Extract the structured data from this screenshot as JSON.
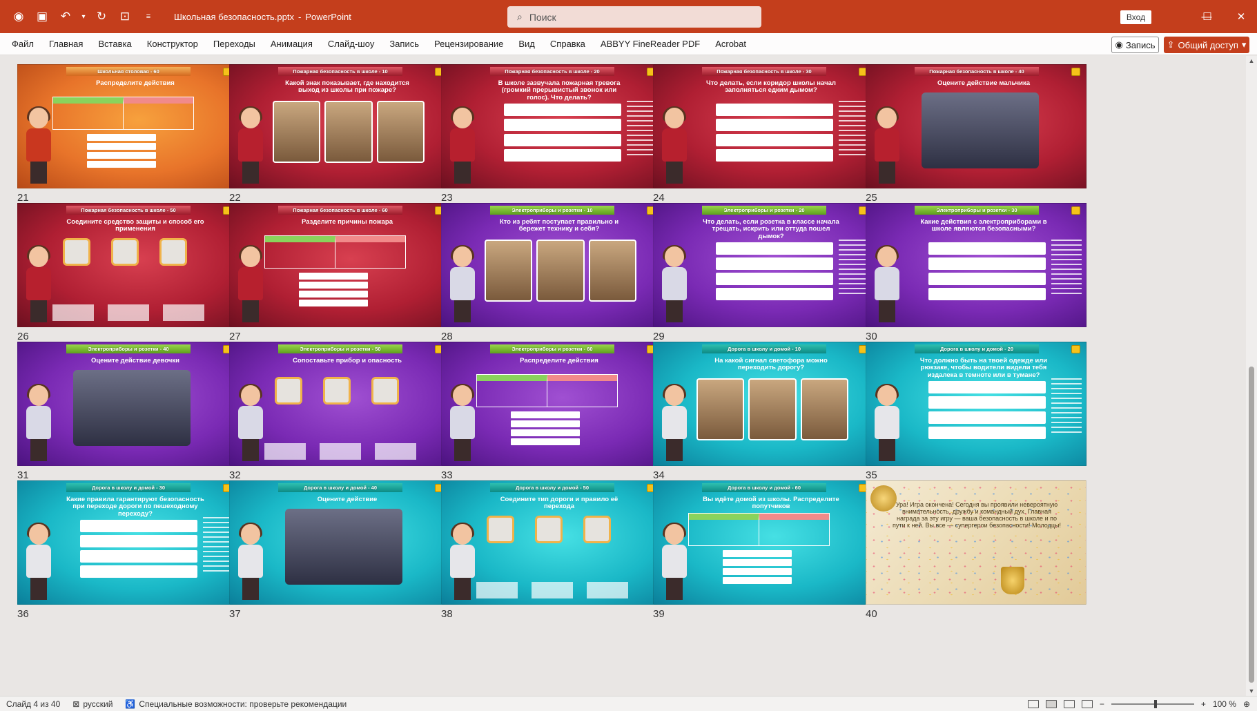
{
  "titlebar": {
    "doc_name": "Школьная безопасность.pptx",
    "separator": "-",
    "app_name": "PowerPoint",
    "search_placeholder": "Поиск",
    "signin_label": "Вход",
    "qa_icons": [
      "autosave-icon",
      "save-icon",
      "undo-icon",
      "undo-dropdown-icon",
      "redo-icon",
      "present-icon",
      "customize-icon"
    ]
  },
  "menu": {
    "items": [
      "Файл",
      "Главная",
      "Вставка",
      "Конструктор",
      "Переходы",
      "Анимация",
      "Слайд-шоу",
      "Запись",
      "Рецензирование",
      "Вид",
      "Справка",
      "ABBYY FineReader PDF",
      "Acrobat"
    ],
    "record_label": "Запись",
    "share_label": "Общий доступ"
  },
  "slides": [
    {
      "num": "21",
      "theme": "orange",
      "header": "Школьная столовая - 60",
      "title": "Распределите действия",
      "layout": "sort"
    },
    {
      "num": "22",
      "theme": "red",
      "header": "Пожарная безопасность в школе - 10",
      "title": "Какой знак показывает, где находится выход из школы при пожаре?",
      "layout": "pics"
    },
    {
      "num": "23",
      "theme": "red",
      "header": "Пожарная безопасность в школе - 20",
      "title": "В школе зазвучала пожарная тревога (громкий прерывистый звонок или голос). Что делать?",
      "layout": "options"
    },
    {
      "num": "24",
      "theme": "red",
      "header": "Пожарная безопасность в школе - 30",
      "title": "Что делать, если коридор школы начал заполняться едким дымом?",
      "layout": "options"
    },
    {
      "num": "25",
      "theme": "red",
      "header": "Пожарная безопасность в школе - 40",
      "title": "Оцените действие мальчика",
      "layout": "scene"
    },
    {
      "num": "26",
      "theme": "red",
      "header": "Пожарная безопасность в школе - 50",
      "title": "Соедините средство защиты и способ его применения",
      "layout": "icons"
    },
    {
      "num": "27",
      "theme": "red",
      "header": "Пожарная безопасность в школе - 60",
      "title": "Разделите причины пожара",
      "layout": "sort"
    },
    {
      "num": "28",
      "theme": "purple",
      "header": "Электроприборы и розетки - 10",
      "title": "Кто из ребят поступает правильно и бережет технику и себя?",
      "layout": "pics"
    },
    {
      "num": "29",
      "theme": "purple",
      "header": "Электроприборы и розетки - 20",
      "title": "Что делать, если розетка в классе начала трещать, искрить или оттуда пошел дымок?",
      "layout": "options"
    },
    {
      "num": "30",
      "theme": "purple",
      "header": "Электроприборы и розетки - 30",
      "title": "Какие действия с электроприборами в школе являются безопасными?",
      "layout": "options"
    },
    {
      "num": "31",
      "theme": "purple",
      "header": "Электроприборы и розетки - 40",
      "title": "Оцените действие девочки",
      "layout": "scene"
    },
    {
      "num": "32",
      "theme": "purple",
      "header": "Электроприборы и розетки - 50",
      "title": "Сопоставьте прибор и опасность",
      "layout": "icons"
    },
    {
      "num": "33",
      "theme": "purple",
      "header": "Электроприборы и розетки - 60",
      "title": "Распределите действия",
      "layout": "sort"
    },
    {
      "num": "34",
      "theme": "teal",
      "header": "Дорога в школу и домой - 10",
      "title": "На какой сигнал светофора можно переходить дорогу?",
      "layout": "pics"
    },
    {
      "num": "35",
      "theme": "teal",
      "header": "Дорога в школу и домой - 20",
      "title": "Что должно быть на твоей одежде или рюкзаке, чтобы водители видели тебя издалека в темноте или в тумане?",
      "layout": "options"
    },
    {
      "num": "36",
      "theme": "teal",
      "header": "Дорога в школу и домой - 30",
      "title": "Какие правила гарантируют безопасность при переходе дороги по пешеходному переходу?",
      "layout": "options"
    },
    {
      "num": "37",
      "theme": "teal",
      "header": "Дорога в школу и домой - 40",
      "title": "Оцените действие",
      "layout": "scene"
    },
    {
      "num": "38",
      "theme": "teal",
      "header": "Дорога в школу и домой - 50",
      "title": "Соедините тип дороги и правило её перехода",
      "layout": "icons"
    },
    {
      "num": "39",
      "theme": "teal",
      "header": "Дорога в школу и домой - 60",
      "title": "Вы идёте домой из школы. Распределите попутчиков",
      "layout": "sort"
    },
    {
      "num": "40",
      "theme": "gold",
      "header": "",
      "title": "Ура! Игра окончена! Сегодня вы проявили невероятную внимательность, дружбу и командный дух. Главная награда за эту игру — ваша безопасность в школе и по пути к ней. Вы все — супергерои безопасности! Молодцы!",
      "layout": "final"
    }
  ],
  "statusbar": {
    "slide_info": "Слайд 4 из 40",
    "language": "русский",
    "accessibility": "Специальные возможности: проверьте рекомендации",
    "zoom": "100 %"
  }
}
